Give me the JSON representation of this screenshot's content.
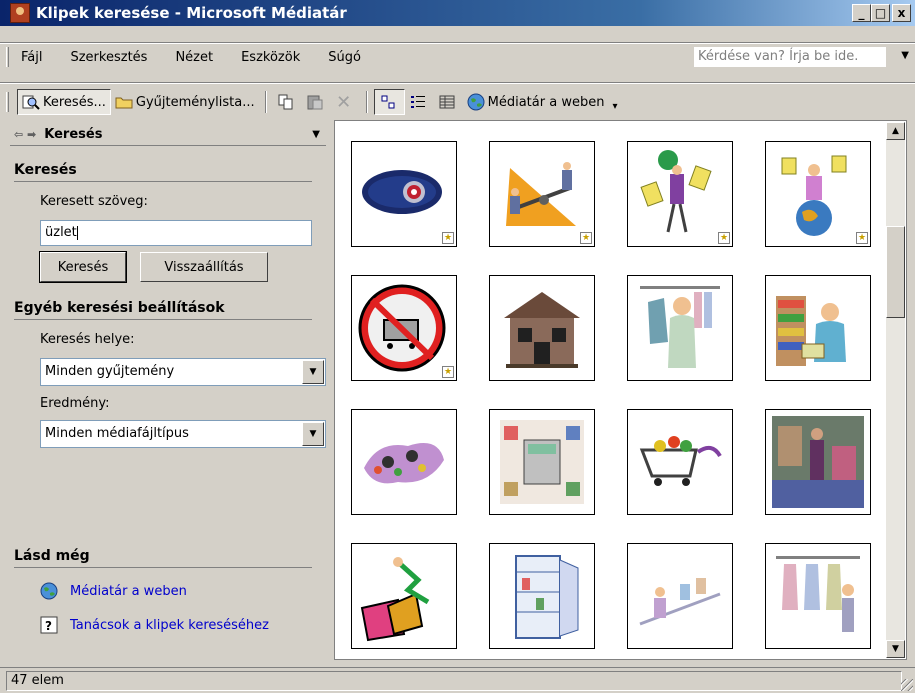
{
  "window": {
    "title": "Klipek keresése - Microsoft Médiatár",
    "controls": {
      "minimize": "_",
      "maximize": "□",
      "close": "x"
    }
  },
  "menubar": {
    "items": [
      {
        "label": "Fájl"
      },
      {
        "label": "Szerkesztés"
      },
      {
        "label": "Nézet"
      },
      {
        "label": "Eszközök"
      },
      {
        "label": "Súgó"
      }
    ],
    "help_placeholder": "Kérdése van? Írja be ide."
  },
  "toolbar": {
    "search_label": "Keresés...",
    "collections_label": "Gyűjteménylista...",
    "web_label": "Médiatár a weben"
  },
  "taskpane": {
    "header": "Keresés",
    "search_section": "Keresés",
    "search_text_label": "Keresett szöveg:",
    "search_text_value": "üzlet",
    "search_button": "Keresés",
    "reset_button": "Visszaállítás",
    "other_section": "Egyéb keresési beállítások",
    "location_label": "Keresés helye:",
    "location_value": "Minden gyűjtemény",
    "result_label": "Eredmény:",
    "result_value": "Minden médiafájltípus",
    "see_also_section": "Lásd még",
    "link_web": "Médiatár a weben",
    "link_tips": "Tanácsok a klipek kereséséhez"
  },
  "gallery": {
    "items": [
      {
        "name": "blue-eye-clip",
        "star": true
      },
      {
        "name": "businessmen-balance-clip",
        "star": true
      },
      {
        "name": "man-globe-papers-clip",
        "star": true
      },
      {
        "name": "woman-on-globe-clip",
        "star": true
      },
      {
        "name": "shopping-cart-sign-clip",
        "star": true
      },
      {
        "name": "store-building-clip",
        "star": false
      },
      {
        "name": "clothing-shopper-clip",
        "star": false
      },
      {
        "name": "grocery-clerk-clip",
        "star": false
      },
      {
        "name": "shopping-people-clip",
        "star": false
      },
      {
        "name": "cash-register-clip",
        "star": false
      },
      {
        "name": "grocery-cart-clip",
        "star": false
      },
      {
        "name": "store-interior-photo",
        "star": false
      },
      {
        "name": "shopping-bags-clip",
        "star": false
      },
      {
        "name": "refrigerator-clip",
        "star": false
      },
      {
        "name": "store-counter-clip",
        "star": false
      },
      {
        "name": "boutique-clip",
        "star": false
      }
    ]
  },
  "statusbar": {
    "text": "47 elem"
  }
}
